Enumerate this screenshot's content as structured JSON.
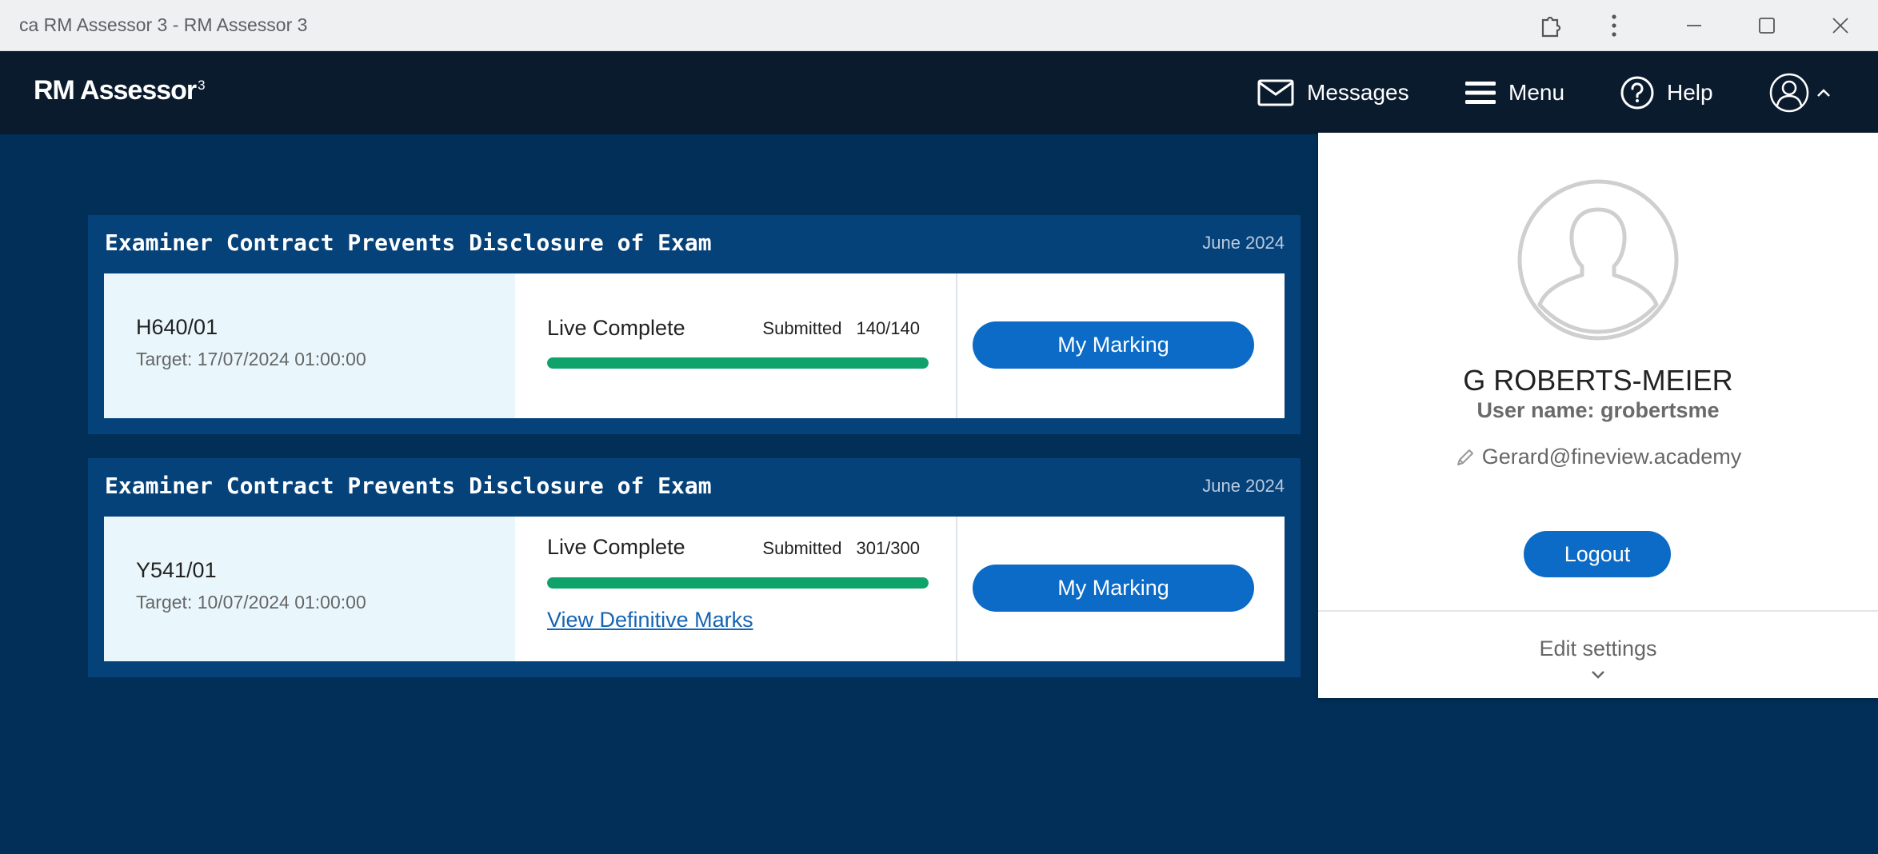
{
  "window": {
    "title": "ca RM Assessor 3 - RM Assessor 3",
    "controls": [
      "extensions-icon",
      "more-vertical-icon",
      "minimize-icon",
      "maximize-icon",
      "close-icon"
    ]
  },
  "header": {
    "logo_text": "RM Assessor",
    "logo_superscript": "3",
    "nav": {
      "messages": "Messages",
      "menu": "Menu",
      "help": "Help"
    }
  },
  "qualifications": [
    {
      "title": "Examiner Contract Prevents Disclosure of Exam",
      "date": "June 2024",
      "code": "H640/01",
      "target": "Target: 17/07/2024 01:00:00",
      "status": "Live Complete",
      "submitted_label": "Submitted",
      "submitted_count": "140/140",
      "progress_fraction": 1.0,
      "button_label": "My Marking",
      "link_label": ""
    },
    {
      "title": "Examiner Contract Prevents Disclosure of Exam",
      "date": "June 2024",
      "code": "Y541/01",
      "target": "Target: 10/07/2024 01:00:00",
      "status": "Live Complete",
      "submitted_label": "Submitted",
      "submitted_count": "301/300",
      "progress_fraction": 1.0,
      "button_label": "My Marking",
      "link_label": "View Definitive Marks"
    }
  ],
  "user_panel": {
    "full_name": "G ROBERTS-MEIER",
    "username": "User name: grobertsme",
    "email": "Gerard@fineview.academy",
    "logout_label": "Logout",
    "edit_settings_label": "Edit settings"
  },
  "colors": {
    "app_header": "#0b1b2e",
    "main_background": "#012f57",
    "card_header": "#06427a",
    "primary_button": "#0b6bc7",
    "progress": "#0fa36b",
    "link": "#1565b5"
  }
}
